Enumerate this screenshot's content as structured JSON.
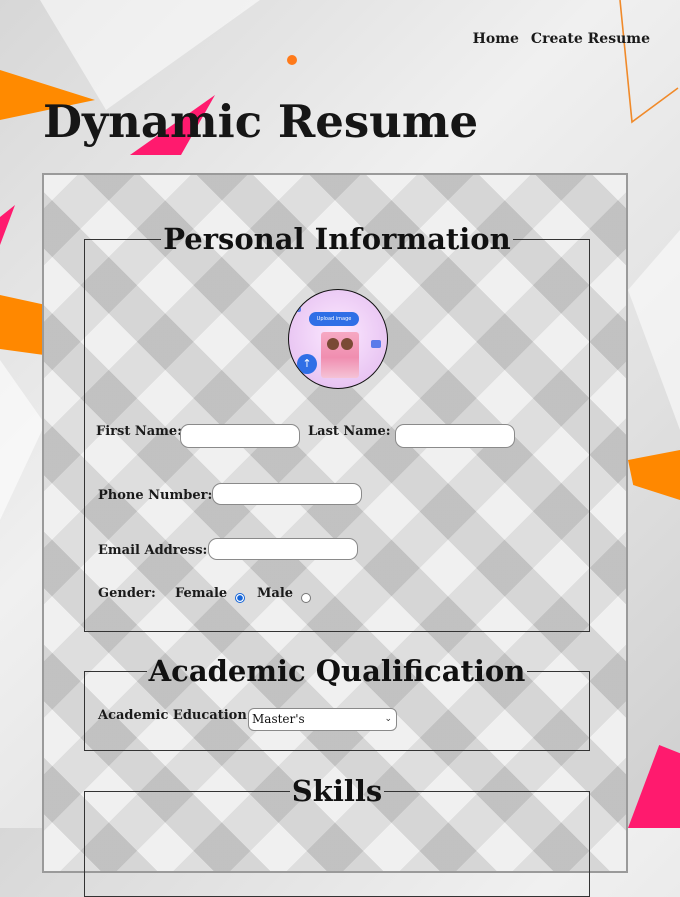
{
  "nav": {
    "items": [
      {
        "label": "Home"
      },
      {
        "label": "Create Resume"
      }
    ]
  },
  "page": {
    "title": "Dynamic Resume"
  },
  "personal": {
    "legend": "Personal Information",
    "avatar": {
      "upload_text": "Upload image",
      "icon": "upload-icon"
    },
    "first_name": {
      "label": "First Name:",
      "value": ""
    },
    "last_name": {
      "label": "Last Name:",
      "value": ""
    },
    "phone": {
      "label": "Phone Number:",
      "value": ""
    },
    "email": {
      "label": "Email Address:",
      "value": ""
    },
    "gender": {
      "label": "Gender:",
      "options": [
        {
          "label": "Female",
          "checked": true
        },
        {
          "label": "Male",
          "checked": false
        }
      ]
    }
  },
  "academic": {
    "legend": "Academic Qualification",
    "education": {
      "label": "Academic Education:",
      "selected": "Master's"
    }
  },
  "skills": {
    "legend": "Skills"
  },
  "colors": {
    "accent_pink": "#ff1a6e",
    "accent_orange": "#ff8800",
    "radio_checked": "#1565d8"
  }
}
